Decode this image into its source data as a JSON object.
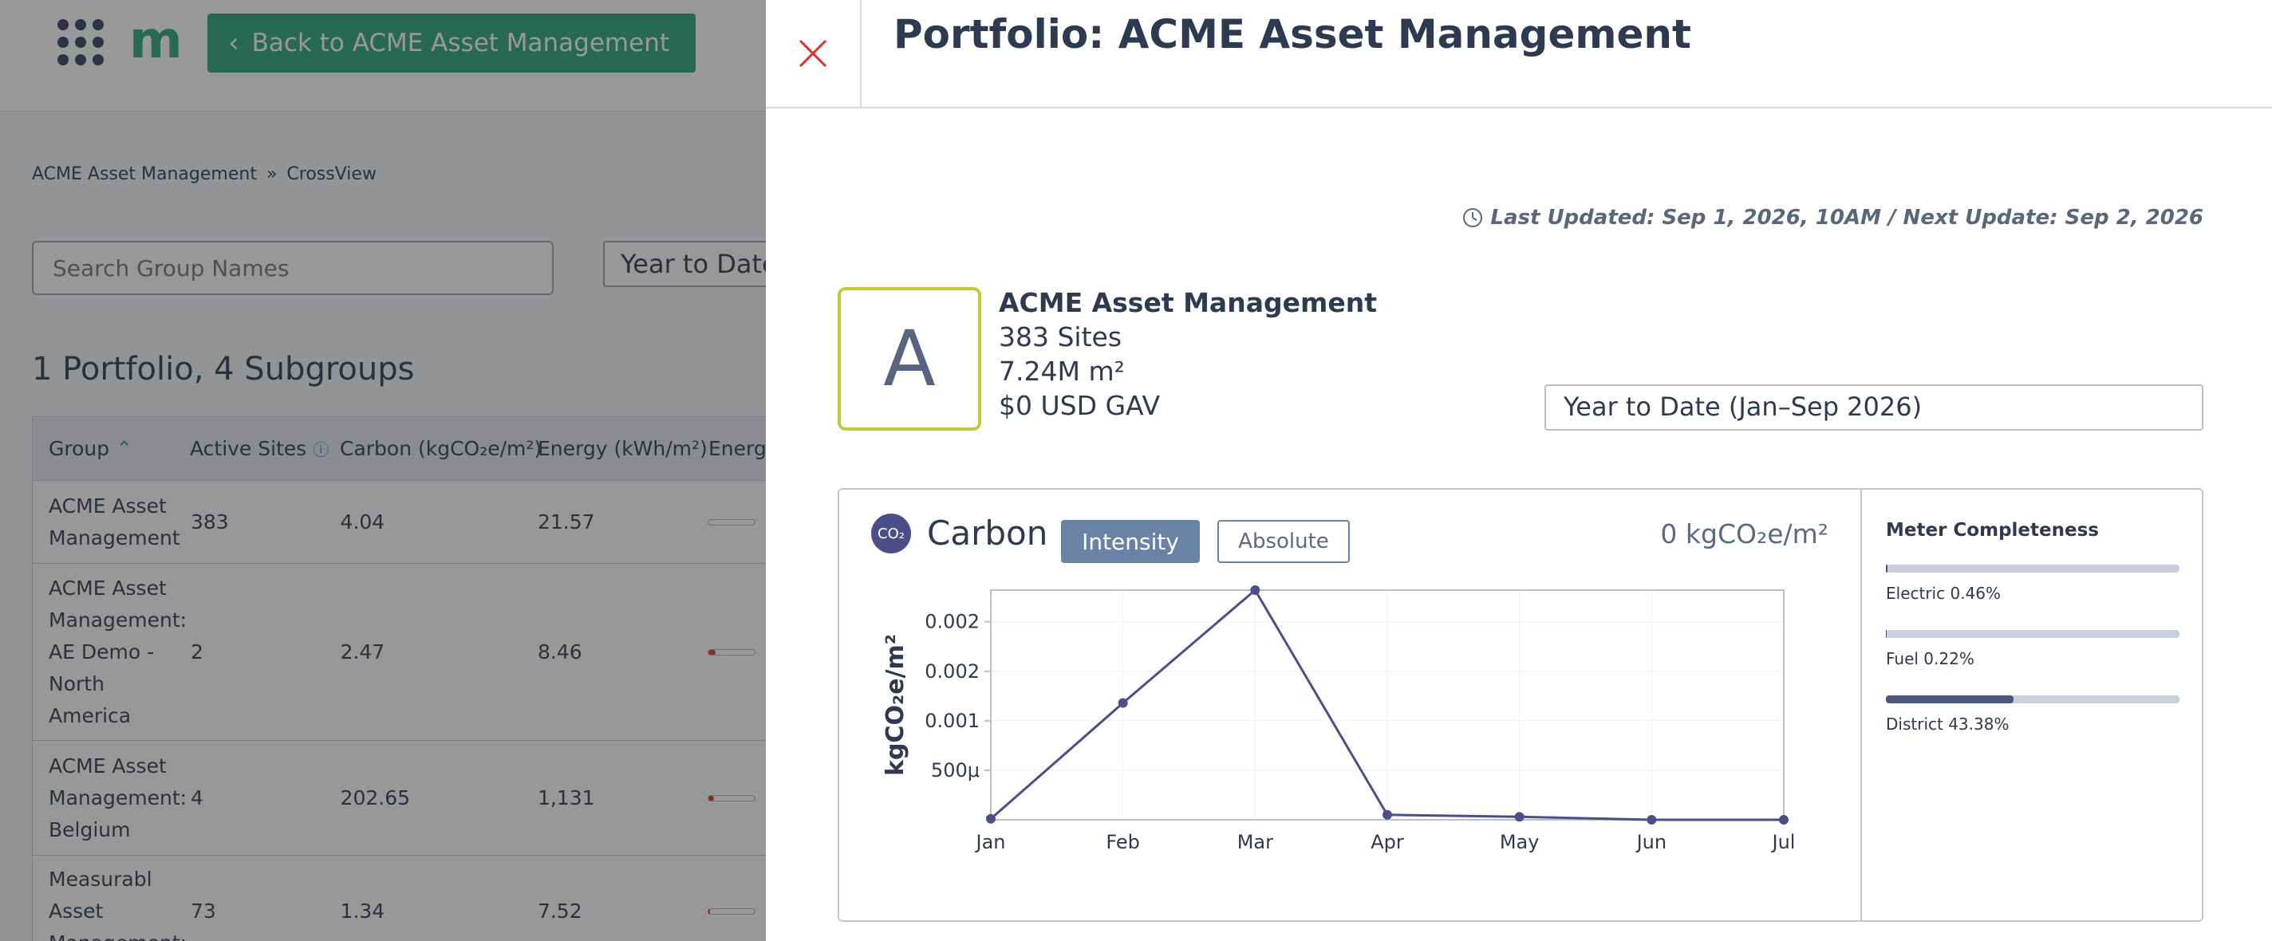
{
  "app": {
    "back_label": "Back to ACME Asset Management",
    "breadcrumb": [
      "ACME Asset Management",
      "»",
      "CrossView"
    ],
    "search_placeholder": "Search Group Names",
    "period_label": "Year to Date",
    "counts": "1 Portfolio, 4 Subgroups",
    "table": {
      "headers": [
        "Group",
        "Active Sites",
        "Carbon (kgCO₂e/m²)",
        "Energy (kWh/m²)",
        "Energy"
      ],
      "rows": [
        {
          "group": "ACME Asset Management",
          "sites": "383",
          "carbon": "4.04",
          "energy": "21.57",
          "bar_fill": 0.0
        },
        {
          "group": "ACME Asset Management: AE Demo - North America",
          "sites": "2",
          "carbon": "2.47",
          "energy": "8.46",
          "bar_fill": 0.15
        },
        {
          "group": "ACME Asset Management: Belgium",
          "sites": "4",
          "carbon": "202.65",
          "energy": "1,131",
          "bar_fill": 0.12
        },
        {
          "group": "Measurabl Asset Management:",
          "sites": "73",
          "carbon": "1.34",
          "energy": "7.52",
          "bar_fill": 0.03
        }
      ]
    }
  },
  "panel": {
    "title": "Portfolio: ACME Asset Management",
    "updated": "Last Updated: Sep 1, 2026, 10AM / Next Update: Sep 2, 2026",
    "avatar_letter": "A",
    "name": "ACME Asset Management",
    "sites": "383 Sites",
    "area": "7.24M m²",
    "gav": "$0 USD GAV",
    "period": "Year to Date (Jan–Sep 2026)",
    "card": {
      "icon": "co2-icon",
      "icon_text": "CO₂",
      "title": "Carbon",
      "intensity_label": "Intensity",
      "absolute_label": "Absolute",
      "value": "0 kgCO₂e/m²"
    },
    "completeness": {
      "title": "Meter Completeness",
      "items": [
        {
          "label": "Electric 0.46%",
          "value": 0.0046
        },
        {
          "label": "Fuel 0.22%",
          "value": 0.0022
        },
        {
          "label": "District 43.38%",
          "value": 0.4338
        }
      ]
    }
  },
  "colors": {
    "accent": "#2aa677",
    "line": "#4a4f8a",
    "button": "#6a82a6",
    "close": "#d9342b"
  },
  "chart_data": {
    "type": "line",
    "categories": [
      "Jan",
      "Feb",
      "Mar",
      "Apr",
      "May",
      "Jun",
      "Jul"
    ],
    "values": [
      1e-05,
      0.00118,
      0.00232,
      5e-05,
      3e-05,
      0.0,
      0.0
    ],
    "ylabel": "kgCO₂e/m²",
    "ytick_labels": [
      "500μ",
      "0.001",
      "0.002",
      "0.002"
    ],
    "ytick_values": [
      0.0005,
      0.001,
      0.0015,
      0.002
    ],
    "ylim": [
      0,
      0.00232
    ],
    "grid": true
  }
}
